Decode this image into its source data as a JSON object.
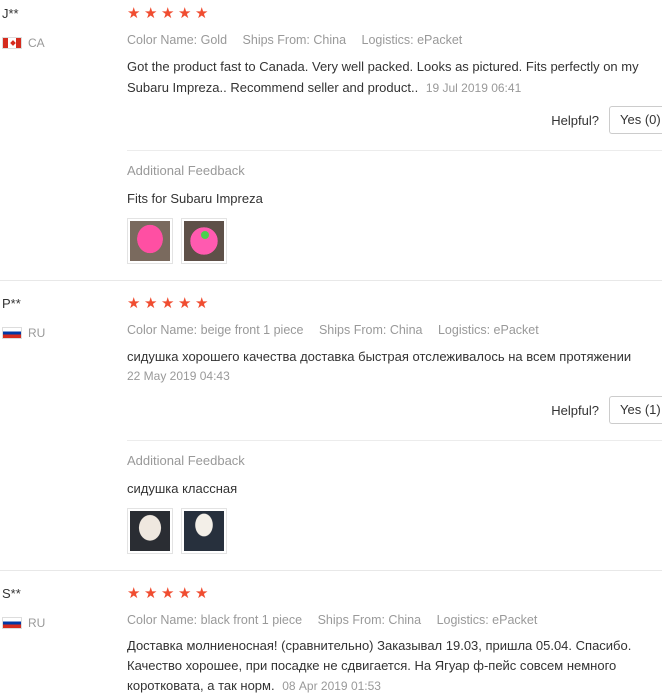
{
  "reviews": [
    {
      "user": "J**",
      "country_code": "CA",
      "flag": "flag-ca",
      "stars": 5,
      "meta": {
        "color": "Color Name: Gold",
        "ships": "Ships From: China",
        "logistics": "Logistics: ePacket"
      },
      "text": "Got the product fast to Canada. Very well packed. Looks as pictured. Fits perfectly on my Subaru Impreza.. Recommend seller and product..",
      "date": "19 Jul 2019 06:41",
      "helpful_label": "Helpful?",
      "yes_label": "Yes (0)",
      "additional_title": "Additional Feedback",
      "additional_text": "Fits for Subaru Impreza",
      "photos": [
        "pink-seat-cover-photo",
        "pink-seat-cover-photo-2"
      ]
    },
    {
      "user": "P**",
      "country_code": "RU",
      "flag": "flag-ru",
      "stars": 5,
      "meta": {
        "color": "Color Name: beige front 1 piece",
        "ships": "Ships From: China",
        "logistics": "Logistics: ePacket"
      },
      "text": "сидушка хорошего качества доставка быстрая отслеживалось на всем протяжении",
      "date": "22 May 2019 04:43",
      "helpful_label": "Helpful?",
      "yes_label": "Yes (1)",
      "additional_title": "Additional Feedback",
      "additional_text": "сидушка классная",
      "photos": [
        "beige-seat-cover-photo",
        "beige-seat-cover-photo-2"
      ]
    },
    {
      "user": "S**",
      "country_code": "RU",
      "flag": "flag-ru",
      "stars": 5,
      "meta": {
        "color": "Color Name: black front 1 piece",
        "ships": "Ships From: China",
        "logistics": "Logistics: ePacket"
      },
      "text": "Доставка молниеносная! (сравнительно) Заказывал 19.03, пришла 05.04. Спасибо. Качество хорошее, при посадке не сдвигается. На Ягуар ф-пейс совсем немного коротковата, а так норм.",
      "date": "08 Apr 2019 01:53"
    }
  ],
  "colors": {
    "star": "#f04d31",
    "muted": "#999999",
    "text": "#333333"
  }
}
